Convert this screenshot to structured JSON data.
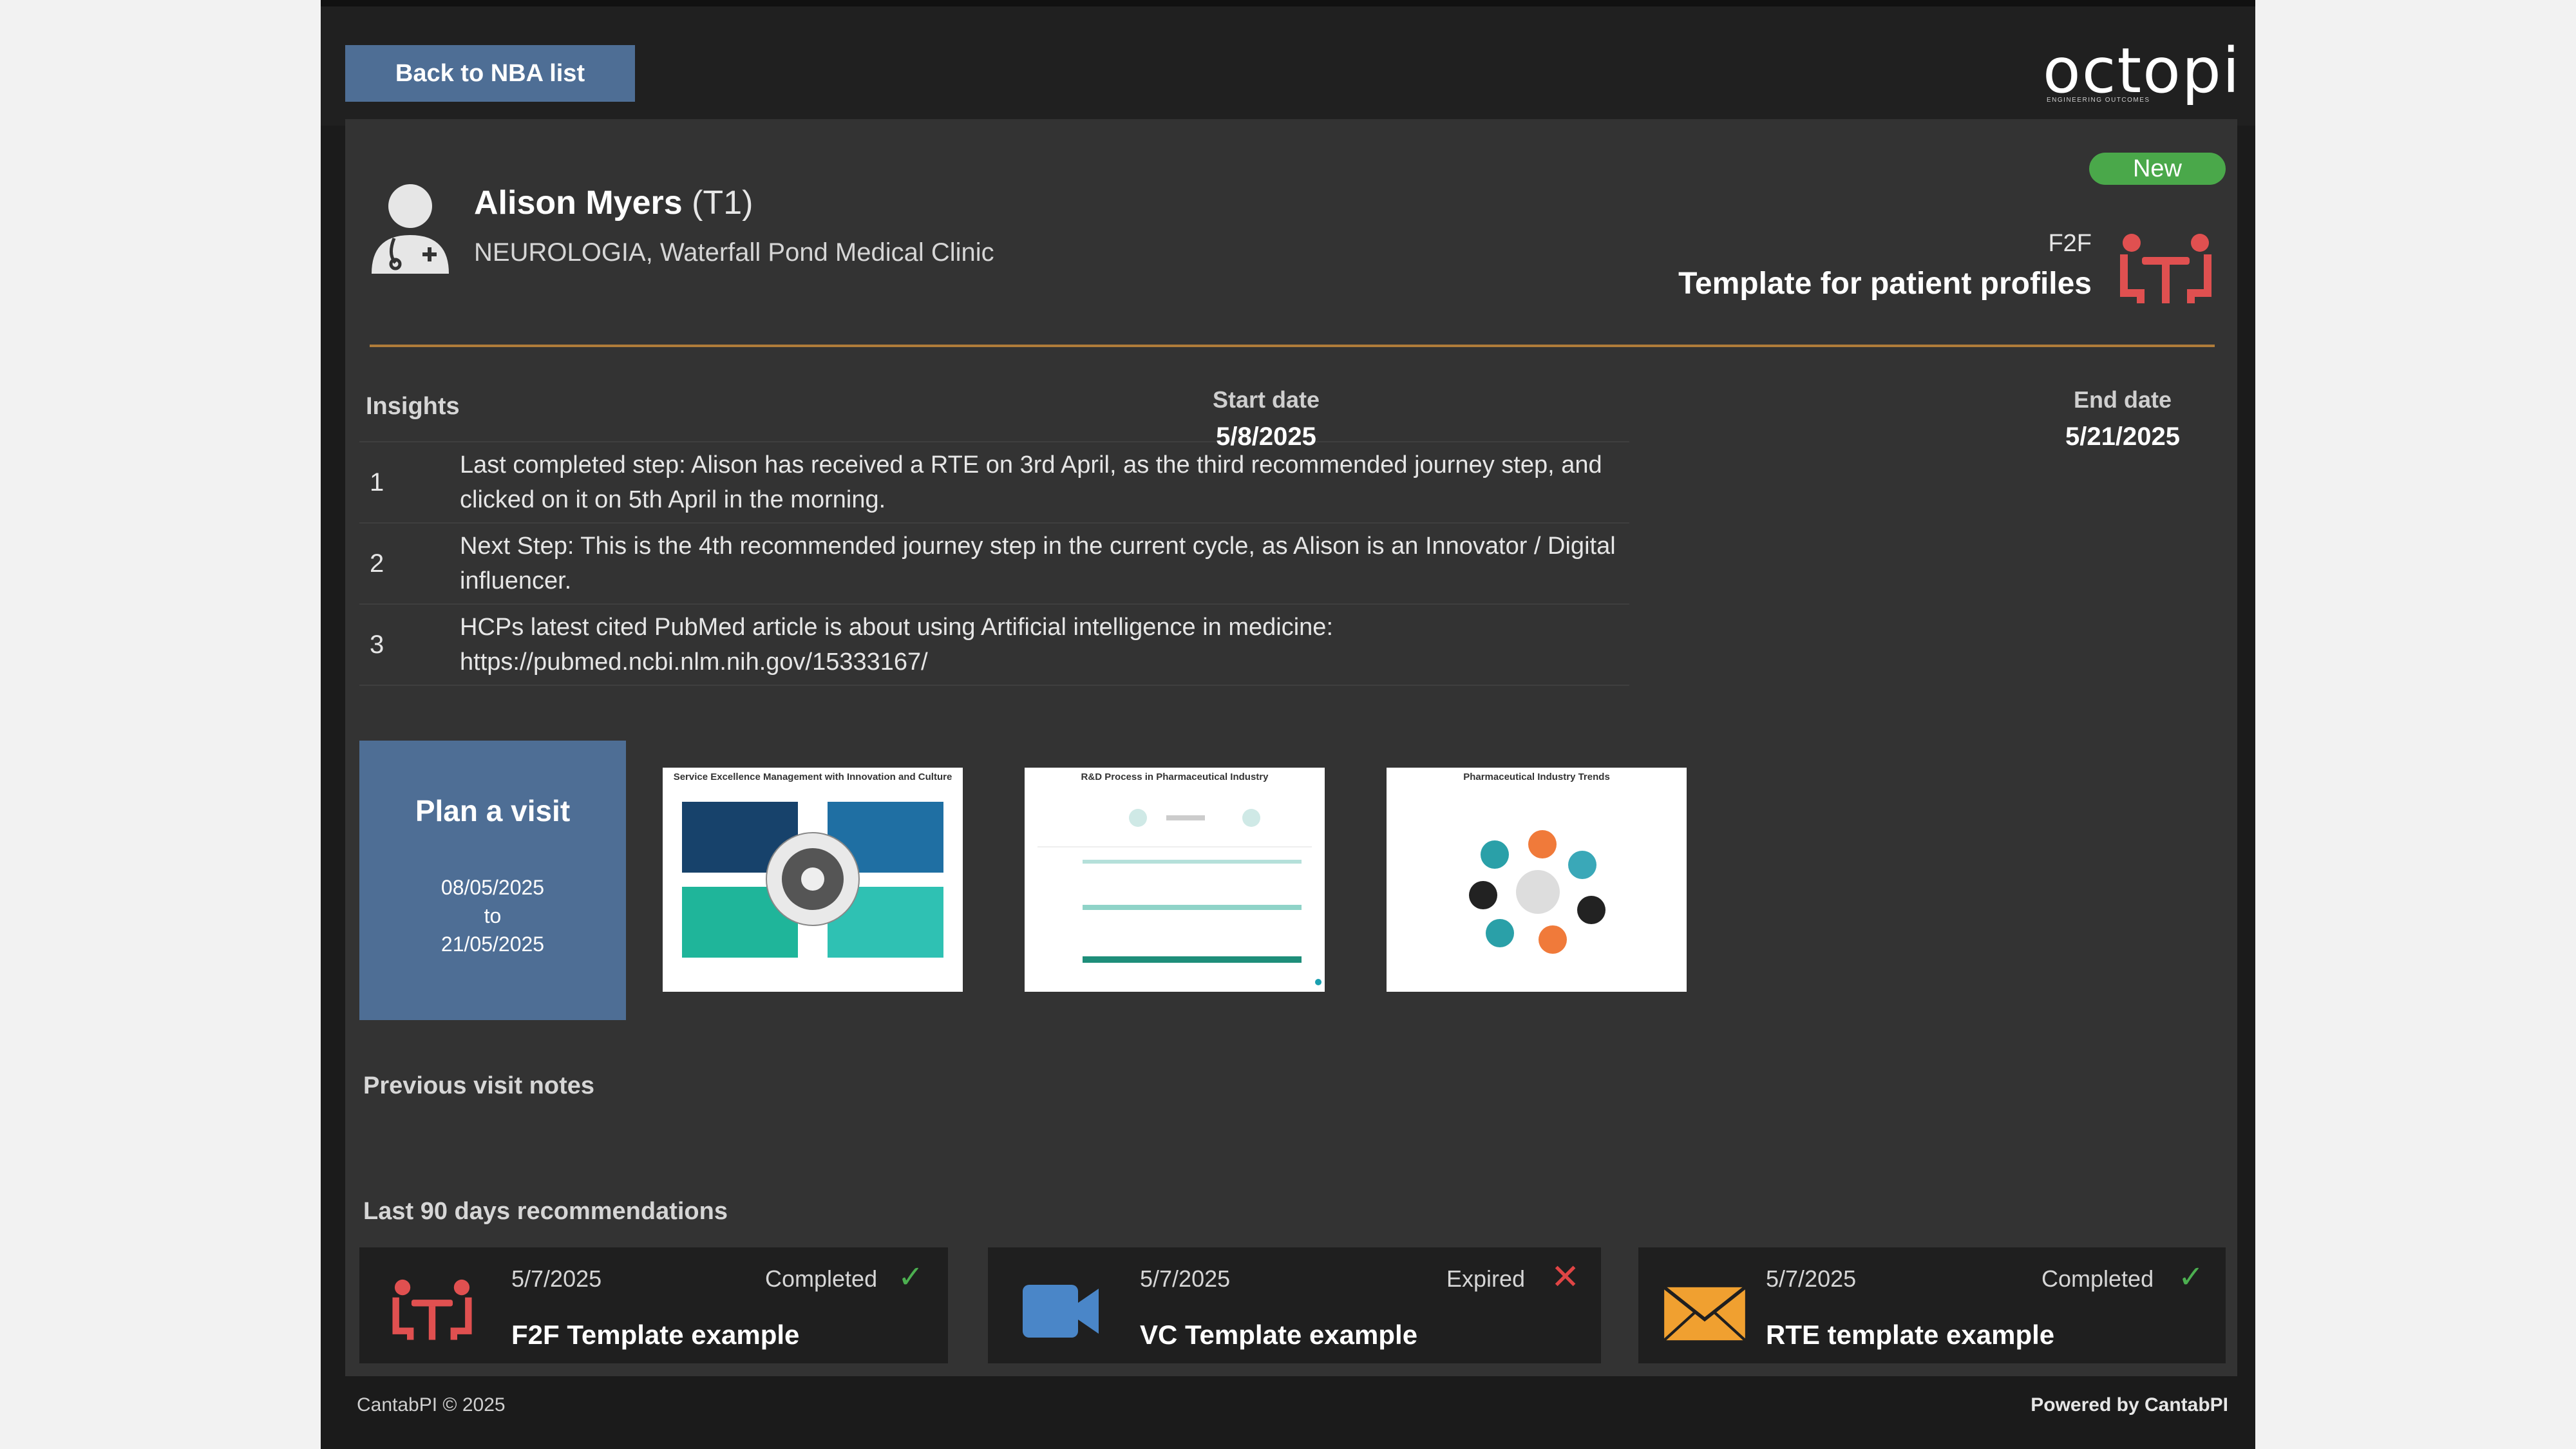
{
  "topbar": {
    "back_label": "Back to NBA list",
    "logo_word": "octopi",
    "logo_tagline": "ENGINEERING OUTCOMES"
  },
  "hcp": {
    "name": "Alison Myers",
    "tier": "(T1)",
    "org": "NEUROLOGIA, Waterfall Pond Medical Clinic"
  },
  "recommendation": {
    "status_badge": "New",
    "channel": "F2F",
    "template": "Template for patient profiles"
  },
  "insights": {
    "title": "Insights",
    "rows": [
      {
        "num": "1",
        "text": "Last completed step: Alison has received a RTE on 3rd April, as the third recommended journey step, and clicked on it on 5th April in the morning."
      },
      {
        "num": "2",
        "text": "Next Step: This is the 4th recommended journey step in the current cycle, as Alison is an Innovator / Digital influencer."
      },
      {
        "num": "3",
        "text": "HCPs latest cited PubMed article is about using Artificial intelligence in medicine: https://pubmed.ncbi.nlm.nih.gov/15333167/"
      }
    ]
  },
  "dates": {
    "start_label": "Start date",
    "start_value": "5/8/2025",
    "end_label": "End date",
    "end_value": "5/21/2025"
  },
  "plan": {
    "title": "Plan a visit",
    "from": "08/05/2025",
    "to_word": "to",
    "to": "21/05/2025"
  },
  "thumbnails": [
    {
      "title": "Service Excellence Management with Innovation and Culture"
    },
    {
      "title": "R&D Process in Pharmaceutical Industry"
    },
    {
      "title": "Pharmaceutical Industry Trends"
    }
  ],
  "sections": {
    "previous_notes": "Previous visit notes",
    "last90": "Last 90 days recommendations"
  },
  "history": [
    {
      "date": "5/7/2025",
      "status": "Completed",
      "name": "F2F Template example",
      "icon": "f2f-meeting-icon"
    },
    {
      "date": "5/7/2025",
      "status": "Expired",
      "name": "VC Template example",
      "icon": "video-camera-icon"
    },
    {
      "date": "5/7/2025",
      "status": "Completed",
      "name": "RTE template example",
      "icon": "envelope-icon"
    }
  ],
  "footer": {
    "left": "CantabPI © 2025",
    "right": "Powered by CantabPI"
  },
  "colors": {
    "accent_blue": "#4e6e95",
    "badge_green": "#4aa84a",
    "divider_gold": "#b07c3a",
    "f2f_red": "#e05050",
    "vc_blue": "#4a86c8",
    "rte_orange": "#f0a030",
    "check_green": "#4caf50",
    "x_red": "#e04545"
  }
}
